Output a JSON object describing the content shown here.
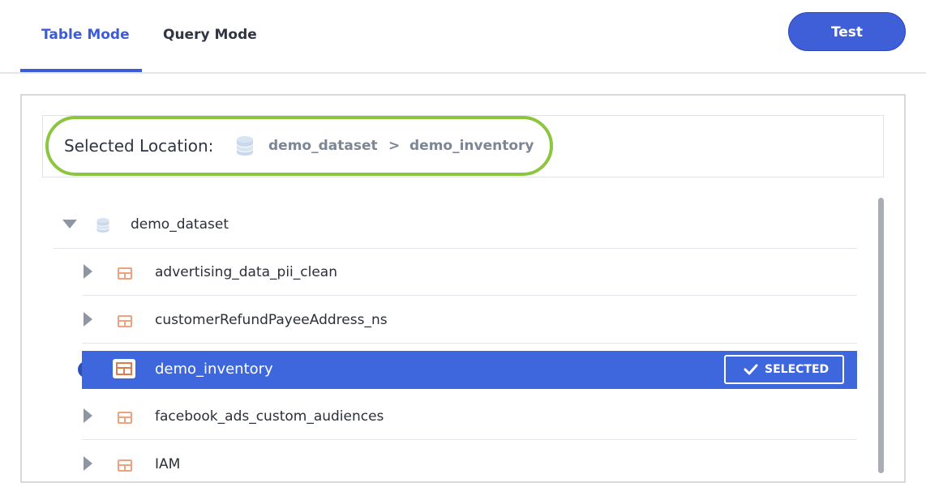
{
  "tabs": [
    {
      "label": "Table Mode",
      "active": true
    },
    {
      "label": "Query Mode",
      "active": false
    }
  ],
  "test_button": {
    "label": "Test"
  },
  "location": {
    "label": "Selected Location:",
    "icon": "database-icon",
    "dataset": "demo_dataset",
    "separator": ">",
    "table": "demo_inventory"
  },
  "tree": {
    "root": {
      "label": "demo_dataset",
      "icon": "database-icon",
      "expanded": true
    },
    "items": [
      {
        "label": "advertising_data_pii_clean",
        "icon": "table-icon",
        "selected": false
      },
      {
        "label": "customerRefundPayeeAddress_ns",
        "icon": "table-icon",
        "selected": false
      },
      {
        "label": "demo_inventory",
        "icon": "table-icon",
        "selected": true,
        "badge": "SELECTED"
      },
      {
        "label": "facebook_ads_custom_audiences",
        "icon": "table-icon",
        "selected": false
      },
      {
        "label": "IAM",
        "icon": "table-icon",
        "selected": false
      }
    ]
  },
  "colors": {
    "accent": "#3f5fd9",
    "selected_row": "#3f67dd",
    "highlight": "#8cc63f",
    "table_icon": "#f0a27c"
  }
}
